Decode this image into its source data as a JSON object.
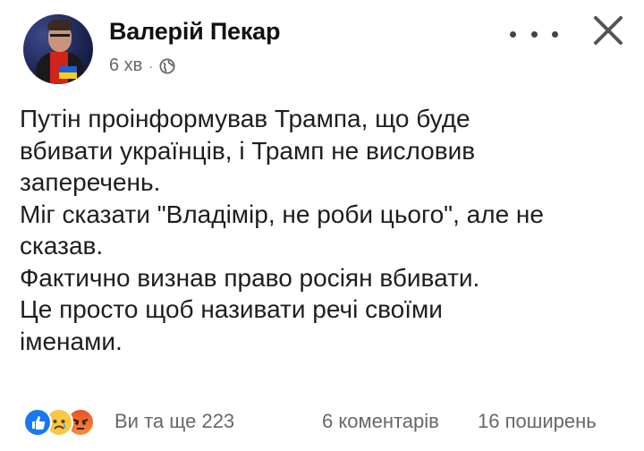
{
  "post": {
    "author": "Валерій Пекар",
    "time": "6 хв",
    "separator": "·",
    "privacy_icon": "globe-icon",
    "text_lines": [
      "Путін проінформував Трампа, що буде",
      "вбивати українців, і Трамп не висловив",
      "заперечень.",
      "Міг сказати \"Владімір, не роби цього\", але не",
      "сказав.",
      "Фактично визнав право росіян вбивати.",
      "Це просто щоб називати речі своїми",
      "іменами."
    ]
  },
  "footer": {
    "reactions": [
      "like-icon",
      "sad-icon",
      "angry-icon"
    ],
    "reactions_text": "Ви та ще 223",
    "comments_text": "6 коментарів",
    "shares_text": "16 поширень"
  },
  "colors": {
    "like": "#1877f2",
    "meta_text": "#65676b"
  }
}
